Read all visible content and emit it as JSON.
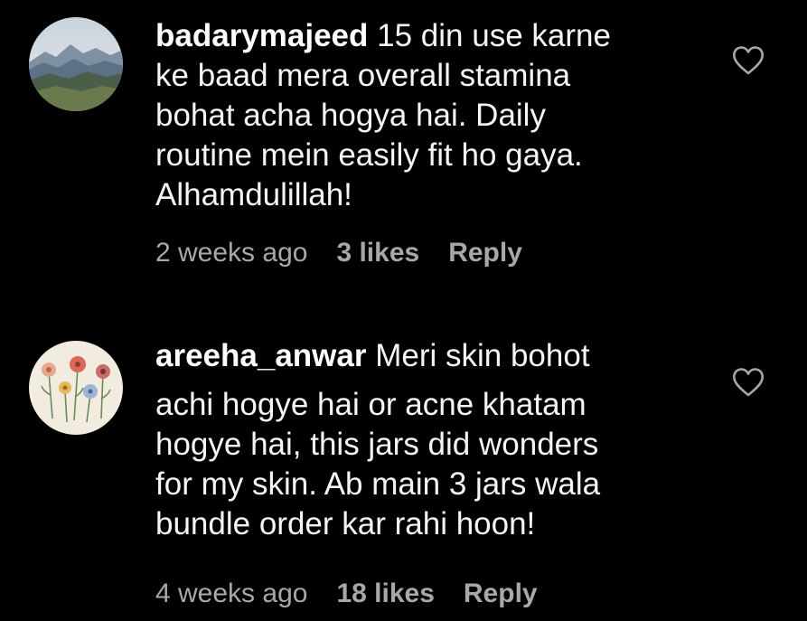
{
  "colors": {
    "background": "#000000",
    "text": "#f5f5f5",
    "meta": "#a8a8a8"
  },
  "comments": [
    {
      "username": "badarymajeed",
      "lines": [
        "15 din use karne",
        "ke baad mera overall stamina",
        "bohat acha hogya hai. Daily",
        "routine mein easily fit ho gaya.",
        "Alhamdulillah!"
      ],
      "time": "2 weeks ago",
      "likes": "3 likes",
      "reply_label": "Reply",
      "avatar_icon": "mountain-landscape-avatar",
      "like_icon": "heart-outline-icon"
    },
    {
      "username": "areeha_anwar",
      "lines": [
        "Meri skin bohot",
        "achi hogye hai or acne khatam",
        "hogye hai, this jars did wonders",
        "for my skin. Ab main 3 jars wala",
        "bundle order kar rahi hoon!"
      ],
      "time": "4 weeks ago",
      "likes": "18 likes",
      "reply_label": "Reply",
      "avatar_icon": "wildflowers-avatar",
      "like_icon": "heart-outline-icon"
    }
  ]
}
